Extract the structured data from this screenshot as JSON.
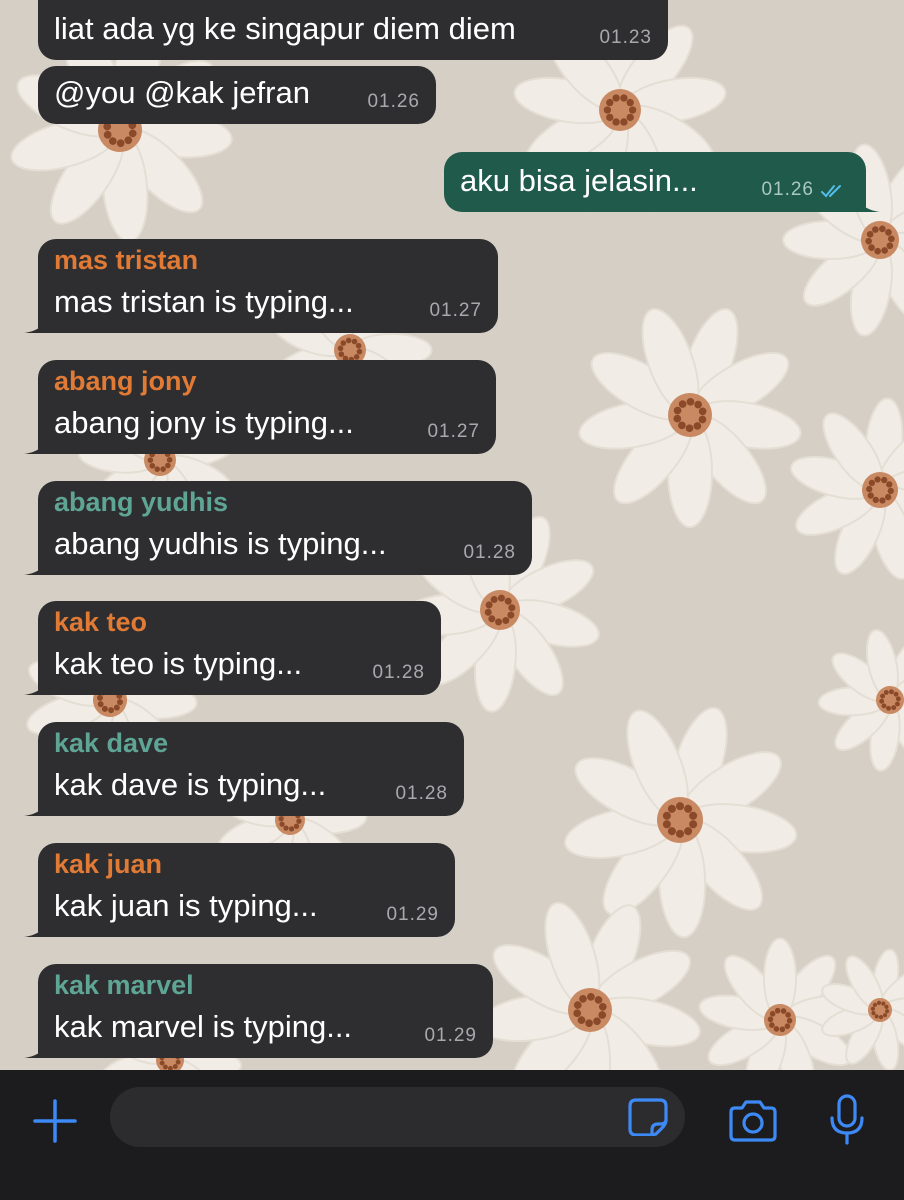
{
  "messages": [
    {
      "direction": "in",
      "text": "liat ada yg ke singapur diem diem",
      "time": "01.23"
    },
    {
      "direction": "in",
      "text": "@you @kak jefran",
      "time": "01.26"
    },
    {
      "direction": "out",
      "text": "aku bisa jelasin...",
      "time": "01.26",
      "status": "read-double-check-icon"
    },
    {
      "direction": "in",
      "sender": "mas tristan",
      "sender_color": "#e07a35",
      "text": "mas tristan is typing...",
      "time": "01.27"
    },
    {
      "direction": "in",
      "sender": "abang jony",
      "sender_color": "#e07a35",
      "text": "abang jony is typing...",
      "time": "01.27"
    },
    {
      "direction": "in",
      "sender": "abang yudhis",
      "sender_color": "#5ea595",
      "text": "abang yudhis is typing...",
      "time": "01.28"
    },
    {
      "direction": "in",
      "sender": "kak teo",
      "sender_color": "#e07a35",
      "text": "kak teo is typing...",
      "time": "01.28"
    },
    {
      "direction": "in",
      "sender": "kak dave",
      "sender_color": "#5ea595",
      "text": "kak dave is typing...",
      "time": "01.28"
    },
    {
      "direction": "in",
      "sender": "kak juan",
      "sender_color": "#e07a35",
      "text": "kak juan is typing...",
      "time": "01.29"
    },
    {
      "direction": "in",
      "sender": "kak marvel",
      "sender_color": "#5ea595",
      "text": "kak marvel is typing...",
      "time": "01.29"
    }
  ],
  "composer": {
    "placeholder": "",
    "icons": [
      "plus-icon",
      "sticker-icon",
      "camera-icon",
      "microphone-icon"
    ],
    "accent_color": "#3d8af7"
  },
  "theme": {
    "wallpaper_color": "#d6cfc6",
    "incoming_bubble": "#2e2e30",
    "outgoing_bubble": "#1f5a4b",
    "read_tick_color": "#53bdeb"
  }
}
